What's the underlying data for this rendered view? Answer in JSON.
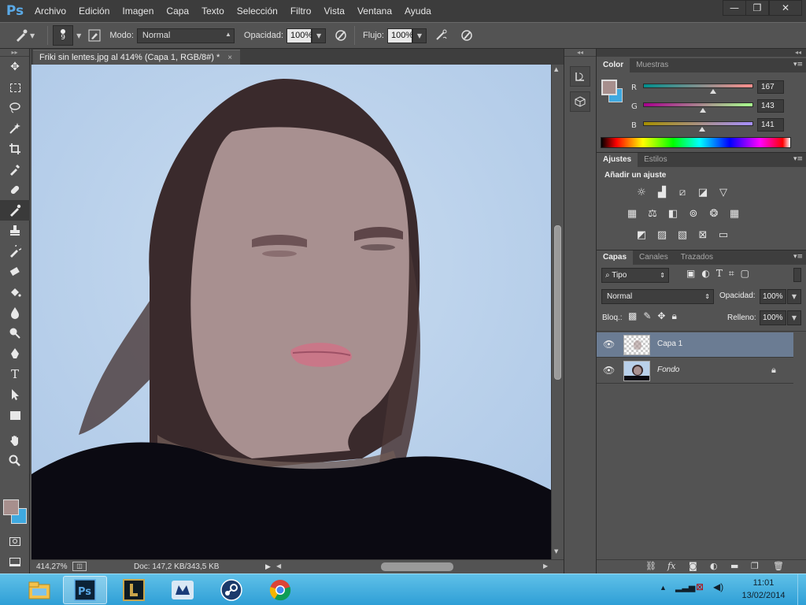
{
  "app": {
    "logo": "Ps"
  },
  "menu": [
    "Archivo",
    "Edición",
    "Imagen",
    "Capa",
    "Texto",
    "Selección",
    "Filtro",
    "Vista",
    "Ventana",
    "Ayuda"
  ],
  "window_controls": {
    "minimize": "—",
    "restore": "❐",
    "close": "✕"
  },
  "options": {
    "brush_size": "9",
    "mode_label": "Modo:",
    "mode_value": "Normal",
    "opacity_label": "Opacidad:",
    "opacity_value": "100%",
    "flow_label": "Flujo:",
    "flow_value": "100%"
  },
  "document": {
    "tab_title": "Friki sin lentes.jpg al 414% (Capa 1, RGB/8#) *",
    "close": "×",
    "zoom": "414,27%",
    "doc_size": "Doc: 147,2 KB/343,5 KB"
  },
  "color_panel": {
    "tabs": [
      "Color",
      "Muestras"
    ],
    "r_label": "R",
    "r": "167",
    "g_label": "G",
    "g": "143",
    "b_label": "B",
    "b": "141",
    "fg_color": "#a78f8d",
    "bg_color": "#3fa9e0",
    "slider_levels": {
      "r": 0.655,
      "g": 0.561,
      "b": 0.553
    }
  },
  "adjust_panel": {
    "tabs": [
      "Ajustes",
      "Estilos"
    ],
    "title": "Añadir un ajuste"
  },
  "layers_panel": {
    "tabs": [
      "Capas",
      "Canales",
      "Trazados"
    ],
    "filter_value": "Tipo",
    "blend_mode": "Normal",
    "opacity_label": "Opacidad:",
    "opacity_value": "100%",
    "lock_label": "Bloq.:",
    "fill_label": "Relleno:",
    "fill_value": "100%",
    "layers": [
      {
        "name": "Capa 1",
        "selected": true,
        "locked": false
      },
      {
        "name": "Fondo",
        "selected": false,
        "locked": true
      }
    ],
    "footer_fx": "fx"
  },
  "taskbar": {
    "time": "11:01",
    "date": "13/02/2014",
    "apps": [
      "explorer",
      "photoshop",
      "league-of-legends",
      "mediafire",
      "steam",
      "chrome"
    ],
    "active_app": "photoshop"
  }
}
